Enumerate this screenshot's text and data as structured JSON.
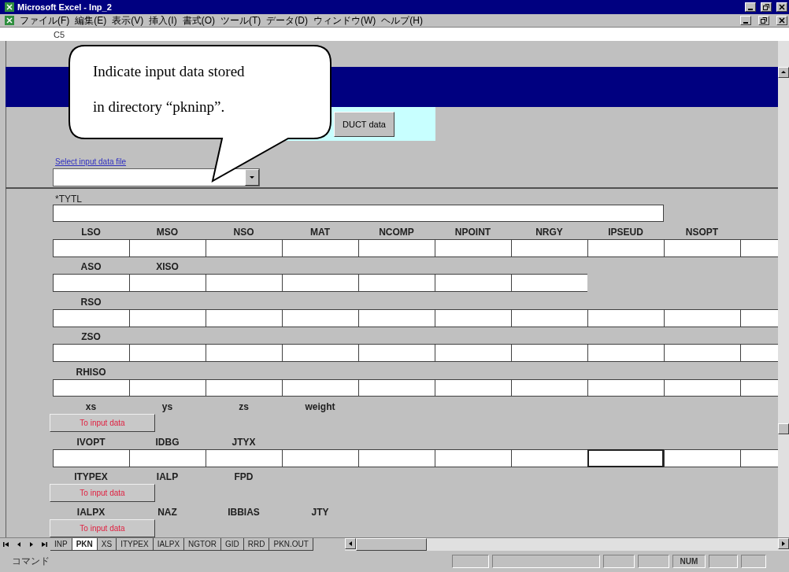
{
  "window": {
    "title": "Microsoft Excel - Inp_2"
  },
  "menu_bar": {
    "items": [
      "ファイル(F)",
      "編集(E)",
      "表示(V)",
      "挿入(I)",
      "書式(O)",
      "ツール(T)",
      "データ(D)",
      "ウィンドウ(W)",
      "ヘルプ(H)"
    ]
  },
  "formula_bar": {
    "cell_ref": "C5"
  },
  "sheet": {
    "duct_button": "DUCT data",
    "file_select": {
      "label": "Select input data file"
    },
    "title_field": {
      "label": "*TYTL"
    },
    "sections": [
      {
        "kind": "fields",
        "labels": [
          "LSO",
          "MSO",
          "NSO",
          "MAT",
          "NCOMP",
          "NPOINT",
          "NRGY",
          "IPSEUD",
          "NSOPT"
        ],
        "cells": [
          {
            "selected": false
          },
          {
            "selected": false
          },
          {
            "selected": false
          },
          {
            "selected": false
          },
          {
            "selected": false
          },
          {
            "selected": false
          },
          {
            "selected": false
          },
          {
            "selected": false
          },
          {
            "selected": false
          },
          {
            "selected": false
          }
        ]
      },
      {
        "kind": "fields",
        "labels": [
          "ASO",
          "XISO"
        ],
        "cells": [
          {
            "selected": false
          },
          {
            "selected": false
          },
          {
            "selected": false
          },
          {
            "selected": false
          },
          {
            "selected": false
          },
          {
            "selected": false
          },
          {
            "selected": false
          }
        ]
      },
      {
        "kind": "fields",
        "labels": [
          "RSO"
        ],
        "cells": [
          {
            "selected": false
          },
          {
            "selected": false
          },
          {
            "selected": false
          },
          {
            "selected": false
          },
          {
            "selected": false
          },
          {
            "selected": false
          },
          {
            "selected": false
          },
          {
            "selected": false
          },
          {
            "selected": false
          },
          {
            "selected": false
          }
        ]
      },
      {
        "kind": "fields",
        "labels": [
          "ZSO"
        ],
        "cells": [
          {
            "selected": false
          },
          {
            "selected": false
          },
          {
            "selected": false
          },
          {
            "selected": false
          },
          {
            "selected": false
          },
          {
            "selected": false
          },
          {
            "selected": false
          },
          {
            "selected": false
          },
          {
            "selected": false
          },
          {
            "selected": false
          }
        ]
      },
      {
        "kind": "fields",
        "labels": [
          "RHISO"
        ],
        "cells": [
          {
            "selected": false
          },
          {
            "selected": false
          },
          {
            "selected": false
          },
          {
            "selected": false
          },
          {
            "selected": false
          },
          {
            "selected": false
          },
          {
            "selected": false
          },
          {
            "selected": false
          },
          {
            "selected": false
          },
          {
            "selected": false
          }
        ]
      },
      {
        "kind": "button",
        "labels": [
          "xs",
          "ys",
          "zs",
          "weight"
        ],
        "button": "To input data"
      },
      {
        "kind": "fields",
        "labels": [
          "IVOPT",
          "IDBG",
          "JTYX"
        ],
        "cells": [
          {
            "selected": false
          },
          {
            "selected": false
          },
          {
            "selected": false
          },
          {
            "selected": false
          },
          {
            "selected": false
          },
          {
            "selected": false
          },
          {
            "selected": false
          },
          {
            "selected": true
          },
          {
            "selected": false
          },
          {
            "selected": false
          }
        ]
      },
      {
        "kind": "button",
        "labels": [
          "ITYPEX",
          "IALP",
          "FPD"
        ],
        "button": "To input data"
      },
      {
        "kind": "button",
        "labels": [
          "IALPX",
          "NAZ",
          "IBBIAS",
          "JTY"
        ],
        "button": "To input data"
      }
    ]
  },
  "callout": {
    "lines": [
      "Indicate input data stored",
      "in directory “pkninp”."
    ]
  },
  "sheet_tabs": [
    {
      "label": "INP",
      "selected": false
    },
    {
      "label": "PKN",
      "selected": true
    },
    {
      "label": "XS",
      "selected": false
    },
    {
      "label": "ITYPEX",
      "selected": false
    },
    {
      "label": "IALPX",
      "selected": false
    },
    {
      "label": "NGTOR",
      "selected": false
    },
    {
      "label": "GID",
      "selected": false
    },
    {
      "label": "RRD",
      "selected": false
    },
    {
      "label": "PKN.OUT",
      "selected": false
    }
  ],
  "status_bar": {
    "mode": "コマンド",
    "indicators": [
      "NUM"
    ]
  }
}
